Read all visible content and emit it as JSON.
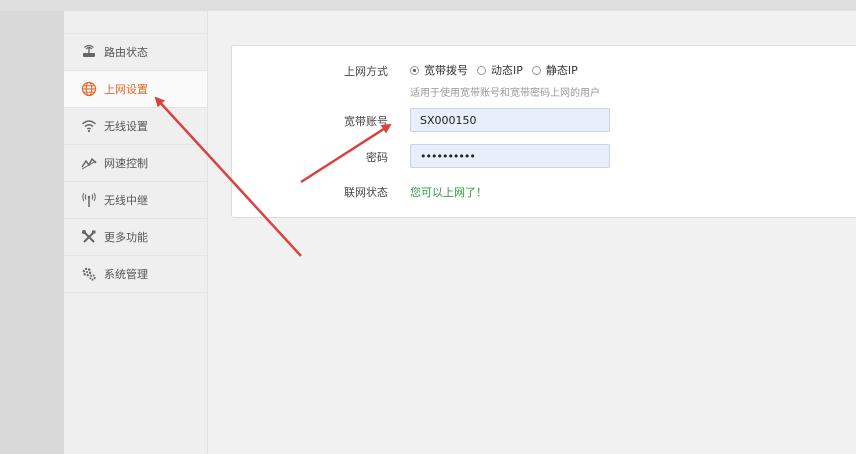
{
  "sidebar": {
    "items": [
      {
        "label": "路由状态",
        "icon": "router-icon"
      },
      {
        "label": "上网设置",
        "icon": "globe-icon",
        "active": true
      },
      {
        "label": "无线设置",
        "icon": "wifi-icon"
      },
      {
        "label": "网速控制",
        "icon": "speed-chart-icon"
      },
      {
        "label": "无线中继",
        "icon": "antenna-icon"
      },
      {
        "label": "更多功能",
        "icon": "tools-icon"
      },
      {
        "label": "系统管理",
        "icon": "gears-icon"
      }
    ]
  },
  "form": {
    "mode_label": "上网方式",
    "modes": [
      {
        "label": "宽带拨号",
        "selected": true
      },
      {
        "label": "动态IP",
        "selected": false
      },
      {
        "label": "静态IP",
        "selected": false
      }
    ],
    "hint": "适用于使用宽带账号和宽带密码上网的用户",
    "account_label": "宽带账号",
    "account_value": "SX000150",
    "password_label": "密码",
    "password_value": "••••••••••",
    "status_label": "联网状态",
    "status_value": "您可以上网了！"
  },
  "colors": {
    "active": "#e26a2c",
    "status_ok": "#2f9a3b",
    "arrow": "#d9423f",
    "field_bg": "#e8effa"
  }
}
